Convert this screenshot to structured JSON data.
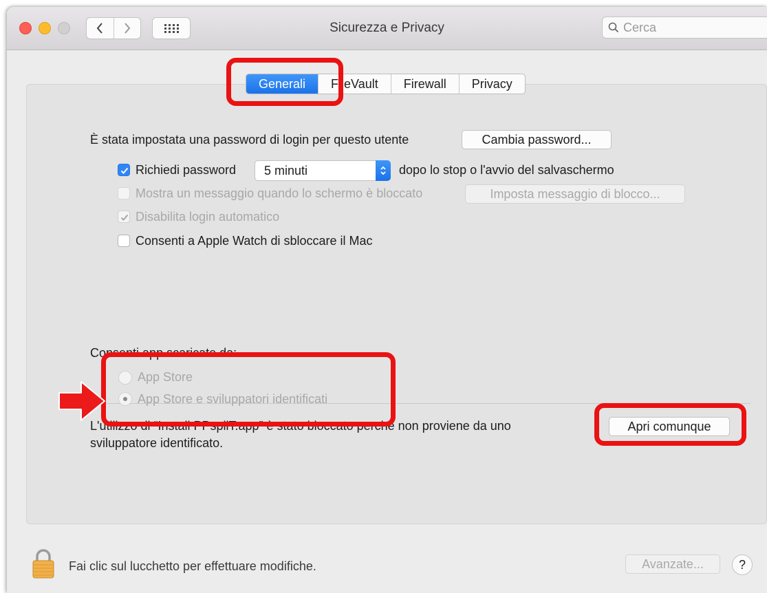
{
  "window": {
    "title": "Sicurezza e Privacy"
  },
  "search": {
    "placeholder": "Cerca"
  },
  "tabs": [
    "Generali",
    "FileVault",
    "Firewall",
    "Privacy"
  ],
  "general": {
    "login_password_text": "È stata impostata una password di login per questo utente",
    "change_password_button": "Cambia password...",
    "require_password_label": "Richiedi password",
    "require_password_value": "5 minuti",
    "require_password_suffix": "dopo lo stop o l'avvio del salvaschermo",
    "show_message_label": "Mostra un messaggio quando lo schermo è bloccato",
    "set_message_button": "Imposta messaggio di blocco...",
    "disable_autologin_label": "Disabilita login automatico",
    "apple_watch_label": "Consenti a Apple Watch di sbloccare il Mac"
  },
  "apps": {
    "heading": "Consenti app scaricate da:",
    "option_appstore": "App Store",
    "option_identified": "App Store e sviluppatori identificati",
    "blocked_line1": "L'utilizzo di “Install PPspliT.app” è stato bloccato perché non proviene da uno",
    "blocked_line2": "sviluppatore identificato.",
    "open_anyway_button": "Apri comunque"
  },
  "footer": {
    "lock_text": "Fai clic sul lucchetto per effettuare modifiche.",
    "advanced_button": "Avanzate...",
    "help_label": "?"
  },
  "colors": {
    "accent": "#1b72ea",
    "highlight": "#ea1212"
  }
}
